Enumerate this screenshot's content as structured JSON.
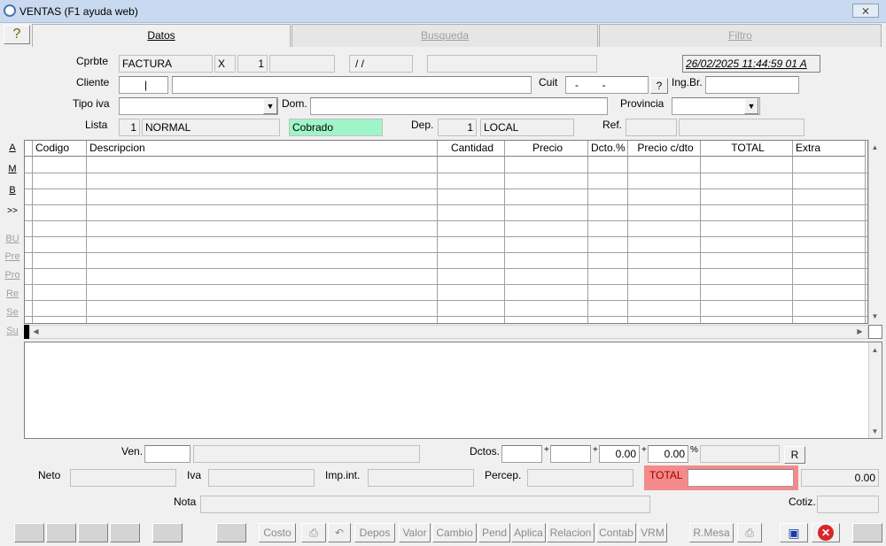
{
  "window": {
    "title": "VENTAS (F1 ayuda web)",
    "close": "⨯"
  },
  "help_button": "?",
  "tabs": [
    {
      "label": "Datos"
    },
    {
      "label": "Busqueda"
    },
    {
      "label": "Filtro"
    }
  ],
  "header": {
    "cprbte_label": "Cprbte",
    "cprbte_type": "FACTURA",
    "cprbte_letter": "X",
    "cprbte_pv": "1",
    "cprbte_number": "",
    "cprbte_date": "/ /",
    "cprbte_extra": "",
    "timestamp": "26/02/2025 11:44:59 01 A",
    "cliente_label": "Cliente",
    "cliente_code": "|",
    "cliente_name": "",
    "cuit_label": "Cuit",
    "cuit_value": "-        -",
    "cuit_help": "?",
    "ingbr_label": "Ing.Br.",
    "ingbr_value": "",
    "tipoiva_label": "Tipo iva",
    "tipoiva_value": "",
    "dom_label": "Dom.",
    "dom_value": "",
    "provincia_label": "Provincia",
    "provincia_value": "",
    "lista_label": "Lista",
    "lista_num": "1",
    "lista_name": "NORMAL",
    "estado": "Cobrado",
    "dep_label": "Dep.",
    "dep_num": "1",
    "dep_name": "LOCAL",
    "ref_label": "Ref.",
    "ref_value": ""
  },
  "side_buttons": [
    "A",
    "M",
    "B",
    ">>",
    "BU",
    "Pre",
    "Pro",
    "Re",
    "Se",
    "Su"
  ],
  "grid": {
    "columns": [
      "Codigo",
      "Descripcion",
      "Cantidad",
      "Precio",
      "Dcto.%",
      "Precio c/dto",
      "TOTAL",
      "Extra"
    ]
  },
  "footer": {
    "ven_label": "Ven.",
    "ven_code": "",
    "ven_name": "",
    "dctos_label": "Dctos.",
    "dcto1": "",
    "plus1": "+",
    "dcto2": "",
    "plus2": "+",
    "dcto3": "0.00",
    "plus3": "+",
    "dcto4": "0.00",
    "pct": "%",
    "dcto_result": "",
    "r_button": "R",
    "neto_label": "Neto",
    "neto_value": "",
    "iva_label": "Iva",
    "iva_value": "",
    "impint_label": "Imp.int.",
    "impint_value": "",
    "percep_label": "Percep.",
    "percep_value": "",
    "total_label": "TOTAL",
    "total_value": "",
    "total_amount": "0.00",
    "nota_label": "Nota",
    "nota_value": "",
    "cotiz_label": "Cotiz.",
    "cotiz_value": ""
  },
  "toolbar": {
    "costo": "Costo",
    "depos": "Depos",
    "valor": "Valor",
    "cambio": "Cambio",
    "pend": "Pend",
    "aplica": "Aplica",
    "relacion": "Relacion",
    "contab": "Contab",
    "vrm": "VRM",
    "rmesa": "R.Mesa"
  },
  "colors": {
    "cobrado_bg": "#a0f5c8",
    "total_bg": "#f58a8a",
    "titlebar": "#c9daf0"
  }
}
